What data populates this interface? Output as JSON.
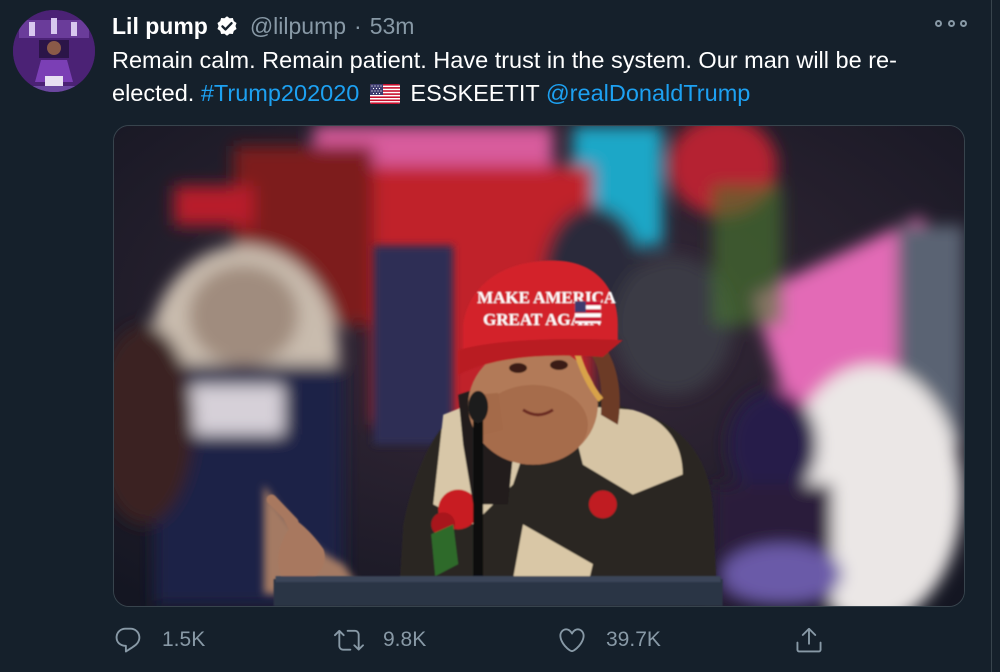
{
  "tweet": {
    "display_name": "Lil pump",
    "handle": "@lilpump",
    "separator": "·",
    "time": "53m",
    "text_part1": "Remain calm. Remain patient. Have trust in the system. Our man will be re-elected. ",
    "hashtag": "#Trump202020",
    "text_part2": " ESSKEETIT ",
    "mention": "@realDonaldTrump",
    "flag_icon": "us-flag-icon",
    "hat_text_line1": "MAKE AMERICA",
    "hat_text_line2": "GREAT AGAIN"
  },
  "actions": {
    "reply_count": "1.5K",
    "retweet_count": "9.8K",
    "like_count": "39.7K"
  },
  "icons": {
    "verified": "verified-badge-icon",
    "more": "more-options-icon",
    "reply": "reply-icon",
    "retweet": "retweet-icon",
    "like": "heart-icon",
    "share": "share-icon"
  },
  "colors": {
    "background": "#15202b",
    "link": "#1da1f2",
    "secondary_text": "#8899a6"
  }
}
